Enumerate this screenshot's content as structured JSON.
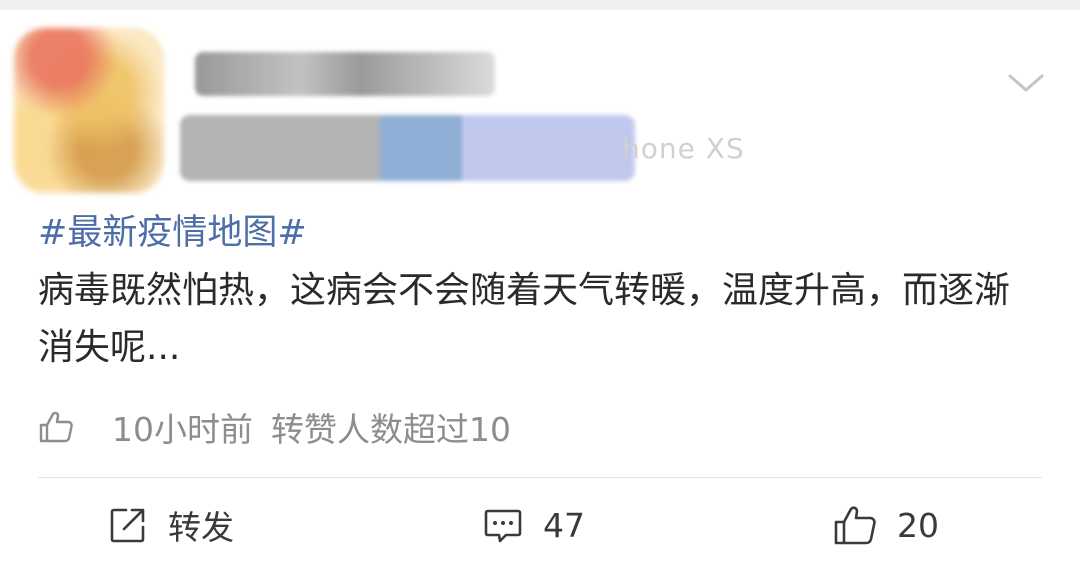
{
  "header": {
    "device_suffix": "hone XS",
    "collapse_icon": "chevron-down-icon"
  },
  "post": {
    "hashtag": "#最新疫情地图#",
    "content": "病毒既然怕热，这病会不会随着天气转暖，温度升高，而逐渐消失呢...",
    "time": "10小时前",
    "repost_info": "转赞人数超过10"
  },
  "actions": {
    "repost_label": "转发",
    "comment_count": "47",
    "like_count": "20"
  },
  "colors": {
    "hashtag": "#4e6ea7",
    "text": "#2a2a2a",
    "meta": "#8d8d8d"
  }
}
